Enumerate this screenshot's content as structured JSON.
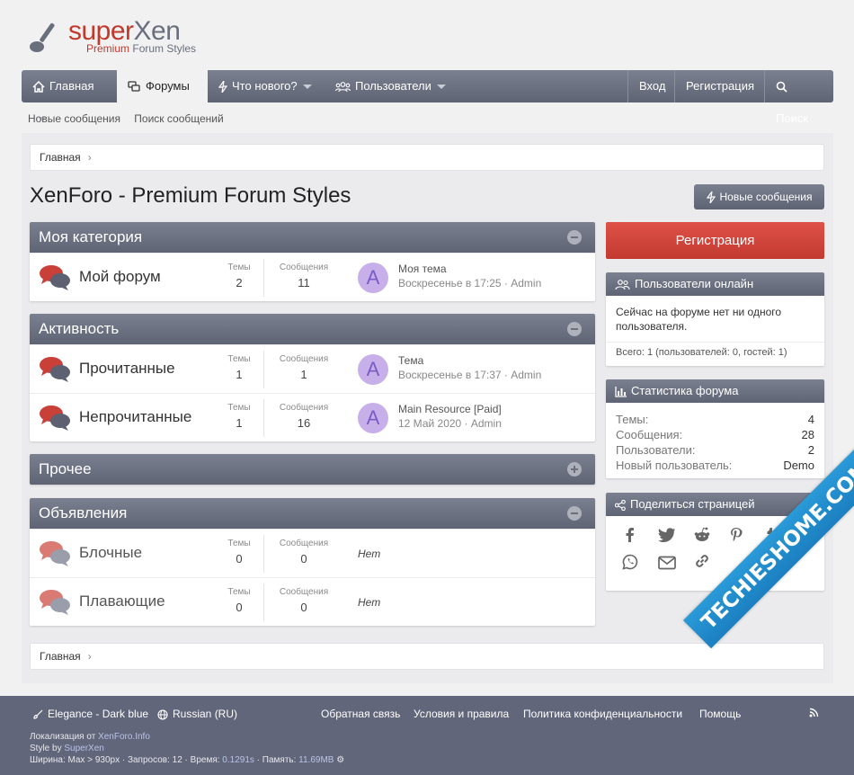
{
  "logo": {
    "brand_prefix": "super",
    "brand_suffix": "Xen",
    "tagline_a": "Premium",
    "tagline_b": "Forum Styles"
  },
  "nav": {
    "home": "Главная",
    "forums": "Форумы",
    "whats_new": "Что нового?",
    "members": "Пользователи",
    "login": "Вход",
    "register": "Регистрация",
    "search": "Поиск"
  },
  "subnav": {
    "new_posts": "Новые сообщения",
    "search_posts": "Поиск сообщений"
  },
  "breadcrumb": {
    "home": "Главная"
  },
  "page": {
    "title": "XenForo - Premium Forum Styles",
    "new_posts_button": "Новые сообщения"
  },
  "categories": [
    {
      "title": "Моя категория",
      "collapsed": false,
      "forums": [
        {
          "name": "Мой форум",
          "threads_label": "Темы",
          "threads": "2",
          "posts_label": "Сообщения",
          "posts": "11",
          "avatar": "A",
          "last_title": "Моя тема",
          "last_meta": "Воскресенье в 17:25 · Admin"
        }
      ]
    },
    {
      "title": "Активность",
      "collapsed": false,
      "forums": [
        {
          "name": "Прочитанные",
          "threads_label": "Темы",
          "threads": "1",
          "posts_label": "Сообщения",
          "posts": "1",
          "avatar": "A",
          "last_title": "Тема",
          "last_meta": "Воскресенье в 17:37 · Admin"
        },
        {
          "name": "Непрочитанные",
          "threads_label": "Темы",
          "threads": "1",
          "posts_label": "Сообщения",
          "posts": "16",
          "avatar": "A",
          "last_title": "Main Resource [Paid]",
          "last_meta": "12 Май 2020 · Admin"
        }
      ]
    },
    {
      "title": "Прочее",
      "collapsed": true,
      "forums": []
    },
    {
      "title": "Объявления",
      "collapsed": false,
      "forums": [
        {
          "name": "Блочные",
          "threads_label": "Темы",
          "threads": "0",
          "posts_label": "Сообщения",
          "posts": "0",
          "none": "Нет"
        },
        {
          "name": "Плавающие",
          "threads_label": "Темы",
          "threads": "0",
          "posts_label": "Сообщения",
          "posts": "0",
          "none": "Нет"
        }
      ]
    }
  ],
  "sidebar": {
    "register_button": "Регистрация",
    "online": {
      "title": "Пользователи онлайн",
      "text": "Сейчас на форуме нет ни одного пользователя.",
      "total": "Всего: 1 (пользователей: 0, гостей: 1)"
    },
    "stats": {
      "title": "Статистика форума",
      "rows": [
        {
          "k": "Темы:",
          "v": "4"
        },
        {
          "k": "Сообщения:",
          "v": "28"
        },
        {
          "k": "Пользователи:",
          "v": "2"
        },
        {
          "k": "Новый пользователь:",
          "v": "Demo"
        }
      ]
    },
    "share": {
      "title": "Поделиться страницей",
      "icons": [
        "facebook-icon",
        "twitter-icon",
        "reddit-icon",
        "pinterest-icon",
        "tumblr-icon",
        "whatsapp-icon",
        "email-icon",
        "link-icon"
      ]
    }
  },
  "footer": {
    "style": "Elegance - Dark blue",
    "language": "Russian (RU)",
    "links": [
      "Обратная связь",
      "Условия и правила",
      "Политика конфиденциальности",
      "Помощь"
    ],
    "localization_prefix": "Локализация от ",
    "localization_link": "XenForo.Info",
    "style_by_prefix": "Style by ",
    "style_by_link": "SuperXen",
    "debug_prefix": "Ширина: Max > 930px · Запросов: 12 · Время: ",
    "debug_time": "0.1291s",
    "debug_mem_prefix": " · Память: ",
    "debug_mem": "11.69MB"
  },
  "watermark": "TECHIESHOME.COM",
  "colors": {
    "nav": "#6a6f7d",
    "register": "#d3463d",
    "footer": "#62667a",
    "avatar": "#c7b0ea",
    "watermark": "#2a9ad8"
  }
}
